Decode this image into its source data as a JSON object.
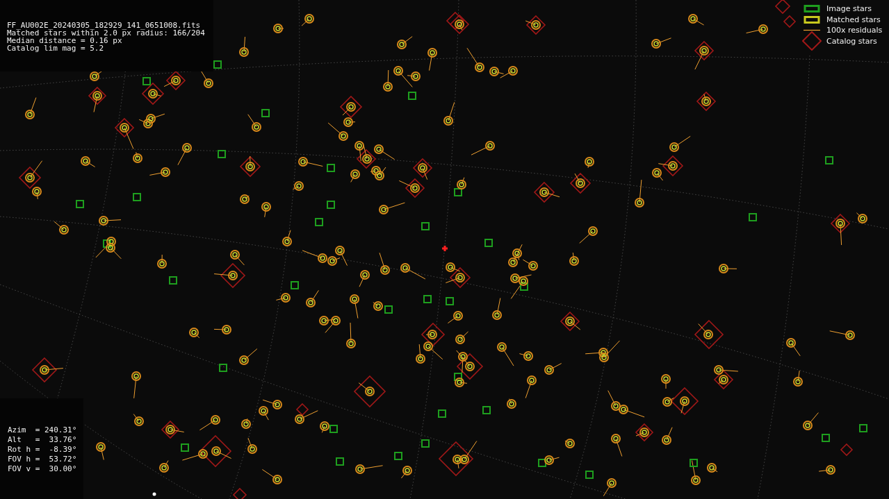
{
  "header": {
    "lines": [
      "FF_AU002E_20240305_182929_141_0651008.fits",
      "Matched stars within 2.0 px radius: 166/204",
      "Median distance = 0.16 px",
      "Catalog lim mag = 5.2"
    ]
  },
  "legend": [
    {
      "kind": "image",
      "label": "Image stars",
      "color": "#1e9e1e"
    },
    {
      "kind": "matched",
      "label": "Matched stars",
      "color": "#c8c81e"
    },
    {
      "kind": "residual",
      "label": "100x residuals",
      "color": "#f0a030"
    },
    {
      "kind": "catalog",
      "label": "Catalog stars",
      "color": "#a01818"
    }
  ],
  "pointing": {
    "lines": [
      "Azim  = 240.31°",
      "Alt   =  33.76°",
      "Rot h =  -8.39°",
      "FOV h =  53.72°",
      "FOV v =  30.00°"
    ]
  }
}
